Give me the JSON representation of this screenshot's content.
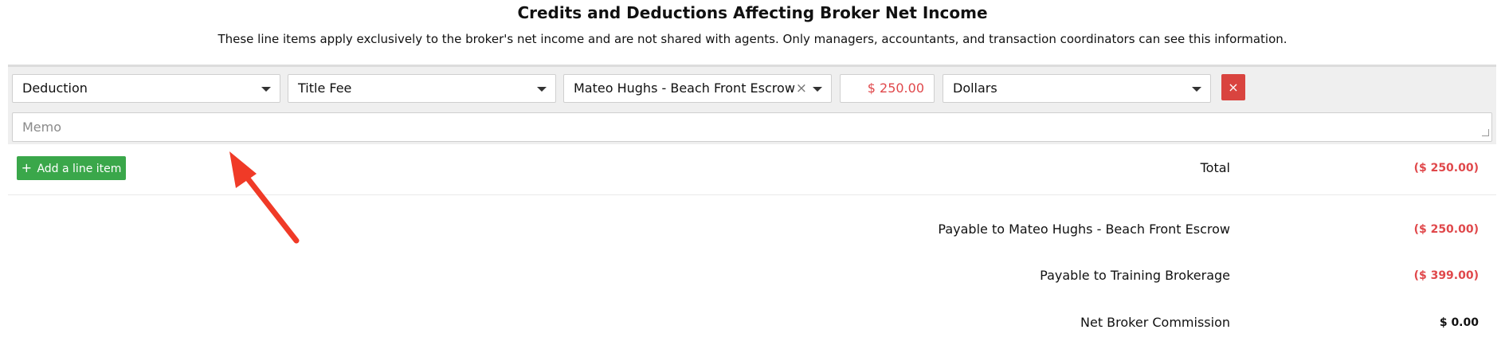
{
  "section": {
    "title": "Credits and Deductions Affecting Broker Net Income",
    "subtitle": "These line items apply exclusively to the broker's net income and are not shared with agents. Only managers, accountants, and transaction coordinators can see this information."
  },
  "line_item": {
    "type": "Deduction",
    "category": "Title Fee",
    "payee": "Mateo Hughs - Beach Front Escrow",
    "amount": "$ 250.00",
    "unit": "Dollars",
    "remove_label": "×",
    "memo_placeholder": "Memo",
    "memo_value": ""
  },
  "actions": {
    "add_line_item_label": "Add a line item",
    "add_icon": "+"
  },
  "summary": {
    "total_label": "Total",
    "total_value": "($ 250.00)",
    "rows": [
      {
        "label": "Payable to Mateo Hughs - Beach Front Escrow",
        "value": "($ 250.00)"
      },
      {
        "label": "Payable to Training Brokerage",
        "value": "($ 399.00)"
      },
      {
        "label": "Net Broker Commission",
        "value": "$ 0.00"
      }
    ]
  },
  "colors": {
    "negative": "#e0484b",
    "add_button": "#3aa74a",
    "remove_button": "#d9443f",
    "annotation_arrow": "#f03a27"
  },
  "icons": {
    "dropdown": "chevron-down-icon",
    "clear": "close-icon",
    "remove": "close-icon",
    "add": "plus-icon",
    "annotation": "arrow-annotation"
  }
}
